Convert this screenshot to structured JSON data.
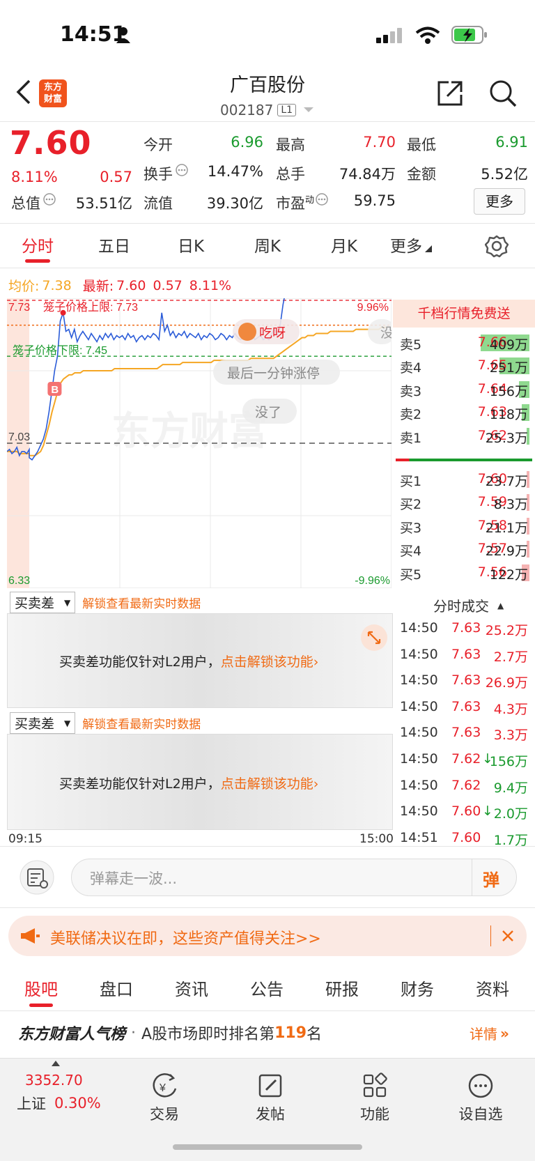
{
  "status_bar": {
    "time": "14:51"
  },
  "header": {
    "title": "广百股份",
    "code": "002187",
    "level": "L1"
  },
  "quote": {
    "price": "7.60",
    "change_pct": "8.11%",
    "change": "0.57",
    "open_label": "今开",
    "open": "6.96",
    "high_label": "最高",
    "high": "7.70",
    "low_label": "最低",
    "low": "6.91",
    "turnover_label": "换手",
    "turnover": "14.47%",
    "volume_label": "总手",
    "volume": "74.84万",
    "amount_label": "金额",
    "amount": "5.52亿",
    "mktcap_label": "总值",
    "mktcap": "53.51亿",
    "float_label": "流值",
    "float": "39.30亿",
    "pe_label": "市盈",
    "pe_sup": "动",
    "pe": "59.75",
    "more_label": "更多"
  },
  "tabs": [
    "分时",
    "五日",
    "日K",
    "周K",
    "月K",
    "更多"
  ],
  "chart": {
    "avg_label": "均价:",
    "avg": "7.38",
    "latest_label": "最新:",
    "latest": "7.60",
    "latest_change": "0.57",
    "latest_pct": "8.11%",
    "y_top": "7.73",
    "y_mid": "7.03",
    "y_bottom": "6.33",
    "pct_top": "9.96%",
    "pct_bottom": "-9.96%",
    "upper_limit_label": "笼子价格上限: 7.73",
    "lower_limit_label": "笼子价格下限: 7.45",
    "bubble_1": "吃呀",
    "bubble_1_tail": "没",
    "bubble_2": "最后一分钟涨停",
    "bubble_3": "没了",
    "buy_marker": "B",
    "watermark": "东方财富",
    "time_start": "09:15",
    "time_end": "15:00"
  },
  "chart_data": {
    "type": "line",
    "x_range": [
      "09:15",
      "15:00"
    ],
    "ylim": [
      6.33,
      7.73
    ],
    "ref_price": 7.03,
    "series": [
      {
        "name": "最新",
        "values": [
          6.99,
          7.0,
          6.98,
          6.99,
          7.01,
          6.97,
          6.99,
          6.99,
          6.98,
          7.0,
          6.96,
          6.95,
          6.97,
          6.99,
          7.02,
          7.05,
          7.1,
          7.18,
          7.28,
          7.38,
          7.45,
          7.62,
          7.66,
          7.57,
          7.58,
          7.54,
          7.58,
          7.52,
          7.55,
          7.57,
          7.55,
          7.53,
          7.56,
          7.54,
          7.52,
          7.55,
          7.53,
          7.56,
          7.54,
          7.56,
          7.53,
          7.55,
          7.54,
          7.55,
          7.53,
          7.56,
          7.54,
          7.55,
          7.52,
          7.54,
          7.55,
          7.53,
          7.55,
          7.54,
          7.56,
          7.55,
          7.53,
          7.66,
          7.57,
          7.6,
          7.55,
          7.57,
          7.54,
          7.56,
          7.55,
          7.57,
          7.54,
          7.56,
          7.55,
          7.54,
          7.56,
          7.53,
          7.55,
          7.54,
          7.56,
          7.55,
          7.53,
          7.54,
          7.56,
          7.55,
          7.53,
          7.55,
          7.54,
          7.56,
          7.54,
          7.53,
          7.55,
          7.54,
          7.55,
          7.56,
          7.53,
          7.54,
          7.55,
          7.53,
          7.54,
          7.53,
          7.56,
          7.58,
          7.55,
          7.6,
          7.7,
          7.77,
          7.82,
          7.88,
          7.93,
          7.84,
          7.95,
          7.86,
          7.9,
          7.83,
          7.8,
          7.85,
          7.82,
          7.78,
          7.77,
          7.79,
          7.78,
          7.8,
          7.78,
          7.79,
          7.77,
          7.8,
          7.78,
          7.79,
          7.81,
          7.78,
          7.8,
          7.79,
          7.82,
          7.78,
          7.8,
          7.79,
          7.81,
          7.85,
          7.91,
          7.89,
          7.86,
          7.85
        ]
      },
      {
        "name": "均价",
        "values": [
          6.99,
          6.99,
          6.99,
          6.99,
          6.99,
          6.98,
          6.98,
          6.98,
          6.98,
          6.98,
          6.97,
          6.97,
          6.97,
          6.98,
          6.99,
          7.02,
          7.07,
          7.12,
          7.18,
          7.23,
          7.28,
          7.32,
          7.34,
          7.35,
          7.36,
          7.36,
          7.37,
          7.37,
          7.37,
          7.38,
          7.38,
          7.38,
          7.38,
          7.38,
          7.38,
          7.38,
          7.38,
          7.38,
          7.38,
          7.38,
          7.39,
          7.39,
          7.39,
          7.39,
          7.39,
          7.39,
          7.39,
          7.39,
          7.39,
          7.39,
          7.39,
          7.39,
          7.39,
          7.39,
          7.39,
          7.39,
          7.4,
          7.41,
          7.41,
          7.41,
          7.41,
          7.41,
          7.41,
          7.41,
          7.42,
          7.42,
          7.42,
          7.42,
          7.42,
          7.42,
          7.42,
          7.42,
          7.42,
          7.42,
          7.42,
          7.43,
          7.43,
          7.43,
          7.43,
          7.43,
          7.43,
          7.43,
          7.43,
          7.43,
          7.43,
          7.43,
          7.43,
          7.43,
          7.44,
          7.44,
          7.44,
          7.44,
          7.44,
          7.44,
          7.44,
          7.44,
          7.44,
          7.45,
          7.46,
          7.47,
          7.48,
          7.49,
          7.5,
          7.51,
          7.52,
          7.53,
          7.54,
          7.54,
          7.55,
          7.55,
          7.55,
          7.56,
          7.56,
          7.56,
          7.56,
          7.56,
          7.57,
          7.57,
          7.57,
          7.57,
          7.57,
          7.57,
          7.57,
          7.57,
          7.57,
          7.58,
          7.58,
          7.58,
          7.58,
          7.58,
          7.58,
          7.58,
          7.58,
          7.58,
          7.59,
          7.59,
          7.59
        ]
      }
    ]
  },
  "order_book": {
    "title": "千档行情免费送",
    "asks": [
      {
        "label": "卖5",
        "price": "7.66",
        "vol": "409万",
        "bar": 1.0
      },
      {
        "label": "卖4",
        "price": "7.65",
        "vol": "251万",
        "bar": 0.62
      },
      {
        "label": "卖3",
        "price": "7.64",
        "vol": "156万",
        "bar": 0.22
      },
      {
        "label": "卖2",
        "price": "7.63",
        "vol": "118万",
        "bar": 0.16
      },
      {
        "label": "卖1",
        "price": "7.62",
        "vol": "25.3万",
        "bar": 0.06
      }
    ],
    "bids": [
      {
        "label": "买1",
        "price": "7.60",
        "vol": "23.7万",
        "bar": 0.04
      },
      {
        "label": "买2",
        "price": "7.59",
        "vol": "8.3万",
        "bar": 0.02
      },
      {
        "label": "买3",
        "price": "7.58",
        "vol": "21.1万",
        "bar": 0.04
      },
      {
        "label": "买4",
        "price": "7.57",
        "vol": "22.9万",
        "bar": 0.04
      },
      {
        "label": "买5",
        "price": "7.56",
        "vol": "122万",
        "bar": 0.16
      }
    ]
  },
  "trades": {
    "title": "分时成交",
    "rows": [
      {
        "time": "14:50",
        "price": "7.63",
        "dir": "",
        "vol": "25.2万",
        "color": "red"
      },
      {
        "time": "14:50",
        "price": "7.63",
        "dir": "",
        "vol": "2.7万",
        "color": "red"
      },
      {
        "time": "14:50",
        "price": "7.63",
        "dir": "",
        "vol": "26.9万",
        "color": "red"
      },
      {
        "time": "14:50",
        "price": "7.63",
        "dir": "",
        "vol": "4.3万",
        "color": "red"
      },
      {
        "time": "14:50",
        "price": "7.63",
        "dir": "",
        "vol": "3.3万",
        "color": "red"
      },
      {
        "time": "14:50",
        "price": "7.62",
        "dir": "↓",
        "vol": "156万",
        "color": "green"
      },
      {
        "time": "14:50",
        "price": "7.62",
        "dir": "",
        "vol": "9.4万",
        "color": "green"
      },
      {
        "time": "14:50",
        "price": "7.60",
        "dir": "↓",
        "vol": "2.0万",
        "color": "green"
      },
      {
        "time": "14:51",
        "price": "7.60",
        "dir": "",
        "vol": "1.7万",
        "color": "green"
      }
    ]
  },
  "panels": [
    {
      "select": "买卖差",
      "unlock_hint": "解锁查看最新实时数据",
      "text": "买卖差功能仅针对L2用户，",
      "link": "点击解锁该功能›"
    },
    {
      "select": "买卖差",
      "unlock_hint": "解锁查看最新实时数据",
      "text": "买卖差功能仅针对L2用户，",
      "link": "点击解锁该功能›"
    }
  ],
  "danmu": {
    "placeholder": "弹幕走一波...",
    "button": "弹"
  },
  "banner": {
    "text": "美联储决议在即，这些资产值得关注>>"
  },
  "bottom_tabs": [
    "股吧",
    "盘口",
    "资讯",
    "公告",
    "研报",
    "财务",
    "资料"
  ],
  "ranking": {
    "brand": "东方财富人气榜",
    "dot": "·",
    "prefix": "A股市场即时排名第",
    "rank": "119",
    "suffix": "名",
    "detail": "详情"
  },
  "nav": {
    "index_value": "3352.70",
    "index_name": "上证",
    "index_pct": "0.30%",
    "items": [
      "交易",
      "发帖",
      "功能",
      "设自选"
    ]
  },
  "colors": {
    "up": "#e8202a",
    "down": "#1a9a2e",
    "accent": "#f06a14",
    "price_line": "#2b5cd8",
    "avg_line": "#f5a623"
  }
}
